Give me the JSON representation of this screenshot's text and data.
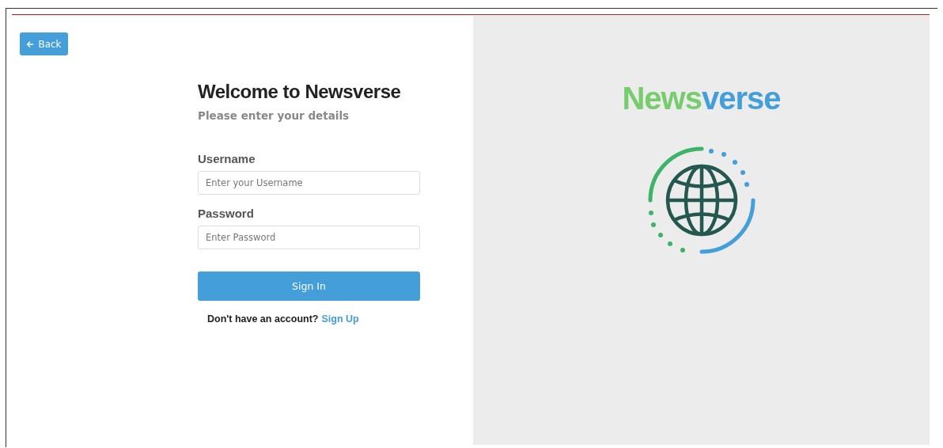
{
  "back_button": {
    "label": "Back"
  },
  "heading": "Welcome to Newsverse",
  "subheading": "Please enter your details",
  "fields": [
    {
      "label": "Username",
      "placeholder": "Enter your Username"
    },
    {
      "label": "Password",
      "placeholder": "Enter Password"
    }
  ],
  "sign_in_button": {
    "label": "Sign In"
  },
  "signup_prompt": {
    "text": "Don't have an account?",
    "link": "Sign Up"
  },
  "logo": [
    {
      "text": "News",
      "color": "#77cc6e"
    },
    {
      "text": "verse",
      "color": "#449ed9"
    }
  ]
}
